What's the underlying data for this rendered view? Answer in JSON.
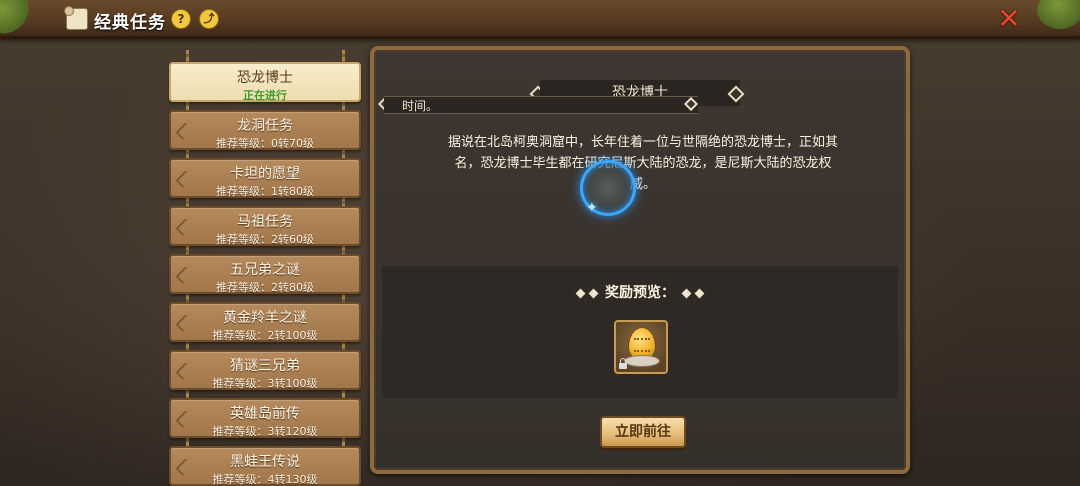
{
  "header": {
    "title": "经典任务",
    "help_label": "?",
    "share_label": "⤴",
    "close_label": "✕"
  },
  "quests": [
    {
      "name": "恐龙博士",
      "level": "正在进行",
      "active": true
    },
    {
      "name": "龙洞任务",
      "level": "推荐等级：0转70级",
      "active": false
    },
    {
      "name": "卡坦的愿望",
      "level": "推荐等级：1转80级",
      "active": false
    },
    {
      "name": "马祖任务",
      "level": "推荐等级：2转60级",
      "active": false
    },
    {
      "name": "五兄弟之谜",
      "level": "推荐等级：2转80级",
      "active": false
    },
    {
      "name": "黄金羚羊之谜",
      "level": "推荐等级：2转100级",
      "active": false
    },
    {
      "name": "猜谜三兄弟",
      "level": "推荐等级：3转100级",
      "active": false
    },
    {
      "name": "英雄岛前传",
      "level": "推荐等级：3转120级",
      "active": false
    },
    {
      "name": "黑蛙王传说",
      "level": "推荐等级：4转130级",
      "active": false
    }
  ],
  "detail": {
    "title": "恐龙博士",
    "tooltip_fragment": "时间。",
    "description": "据说在北岛柯奥洞窟中，长年住着一位与世隔绝的恐龙博士，正如其名，恐龙博士毕生都在研究尼斯大陆的恐龙，是尼斯大陆的恐龙权威。",
    "reward_title": "奖励预览：",
    "reward_item_icon": "dinosaur-egg-icon",
    "go_button_label": "立即前往"
  },
  "colors": {
    "accent_gold": "#f2c742",
    "active_status_green": "#3c9a2a",
    "close_red": "#e3472a",
    "loading_blue": "#3aa7ff"
  }
}
